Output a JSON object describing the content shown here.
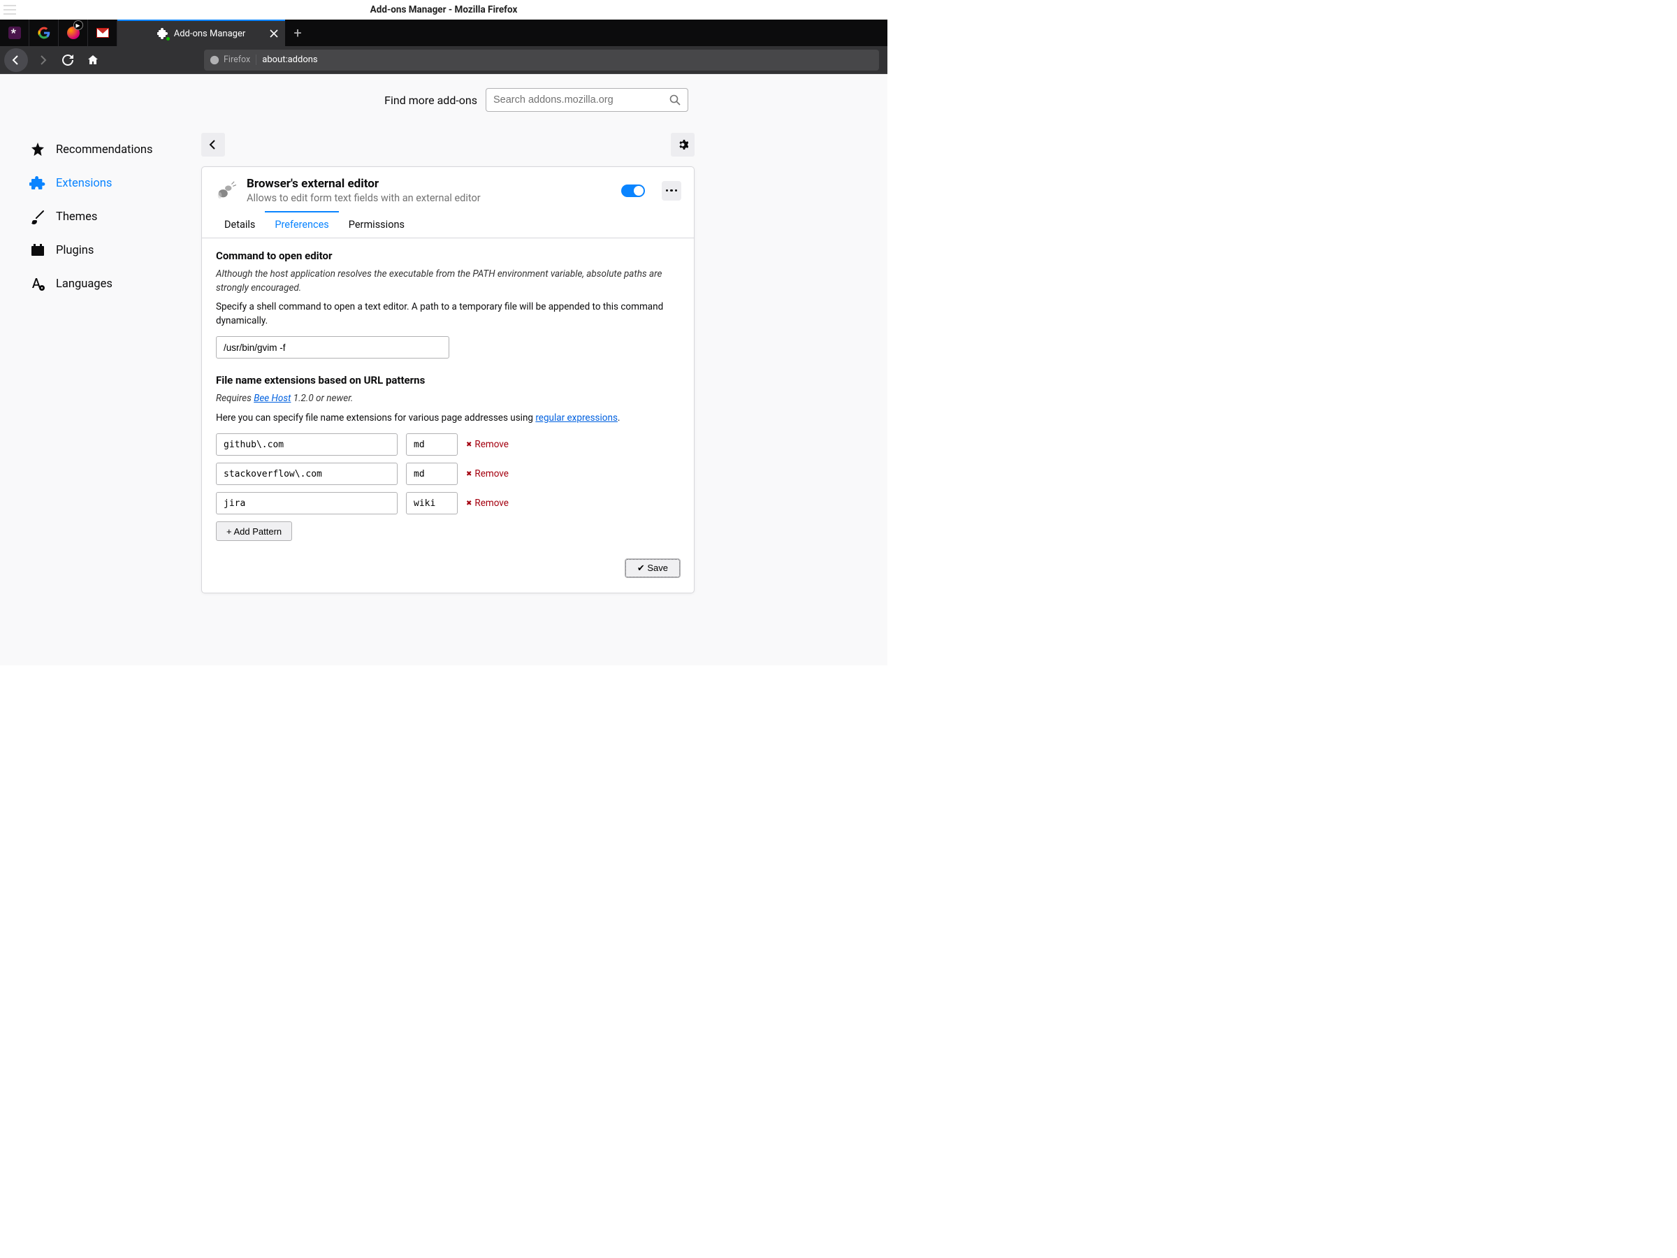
{
  "window": {
    "title": "Add-ons Manager - Mozilla Firefox"
  },
  "tabbar": {
    "active_tab_title": "Add-ons Manager",
    "new_tab_glyph": "+"
  },
  "navbar": {
    "identity_label": "Firefox",
    "url": "about:addons"
  },
  "addons_header": {
    "find_more": "Find more add-ons",
    "search_placeholder": "Search addons.mozilla.org"
  },
  "sidebar": {
    "items": [
      {
        "label": "Recommendations"
      },
      {
        "label": "Extensions"
      },
      {
        "label": "Themes"
      },
      {
        "label": "Plugins"
      },
      {
        "label": "Languages"
      }
    ]
  },
  "extension": {
    "title": "Browser's external editor",
    "description": "Allows to edit form text fields with an external editor"
  },
  "detail_tabs": {
    "details": "Details",
    "preferences": "Preferences",
    "permissions": "Permissions"
  },
  "prefs": {
    "section1_heading": "Command to open editor",
    "section1_note": "Although the host application resolves the executable from the PATH environment variable, absolute paths are strongly encouraged.",
    "section1_desc": "Specify a shell command to open a text editor. A path to a temporary file will be appended to this command dynamically.",
    "editor_command": "/usr/bin/gvim -f",
    "section2_heading": "File name extensions based on URL patterns",
    "requires_prefix": "Requires ",
    "requires_link": "Bee Host",
    "requires_suffix": " 1.2.0 or newer.",
    "section2_desc_a": "Here you can specify file name extensions for various page addresses using ",
    "section2_link": "regular expressions",
    "section2_desc_b": ".",
    "patterns": [
      {
        "pattern": "github\\.com",
        "ext": "md",
        "remove": "Remove"
      },
      {
        "pattern": "stackoverflow\\.com",
        "ext": "md",
        "remove": "Remove"
      },
      {
        "pattern": "jira",
        "ext": "wiki",
        "remove": "Remove"
      }
    ],
    "add_pattern": "+ Add Pattern",
    "save": "✔ Save"
  }
}
